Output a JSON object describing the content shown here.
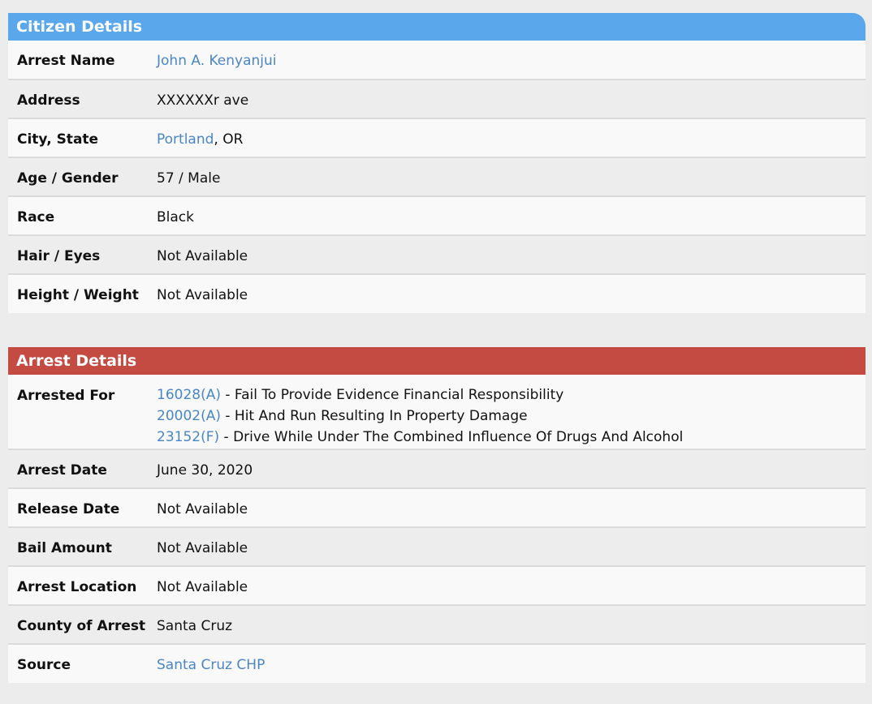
{
  "citizen": {
    "header": "Citizen Details",
    "header_color": "#5aa8eb",
    "rows": [
      {
        "label": "Arrest Name",
        "value": "John A. Kenyanjui"
      },
      {
        "label": "Address",
        "value": "XXXXXXr ave"
      },
      {
        "label": "City, State",
        "city": "Portland",
        "state": ", OR"
      },
      {
        "label": "Age / Gender",
        "value": "57 / Male"
      },
      {
        "label": "Race",
        "value": "Black"
      },
      {
        "label": "Hair / Eyes",
        "value": "Not Available"
      },
      {
        "label": "Height / Weight",
        "value": "Not Available"
      }
    ]
  },
  "arrest": {
    "header": "Arrest Details",
    "header_color": "#c44b42",
    "charges_label": "Arrested For",
    "charges": [
      {
        "code": "16028(A)",
        "description": " - Fail To Provide Evidence Financial Responsibility"
      },
      {
        "code": "20002(A)",
        "description": " - Hit And Run Resulting In Property Damage"
      },
      {
        "code": "23152(F)",
        "description": " - Drive While Under The Combined Influence Of Drugs And Alcohol"
      }
    ],
    "rows": [
      {
        "label": "Arrest Date",
        "value": "June 30, 2020"
      },
      {
        "label": "Release Date",
        "value": "Not Available"
      },
      {
        "label": "Bail Amount",
        "value": "Not Available"
      },
      {
        "label": "Arrest Location",
        "value": "Not Available"
      },
      {
        "label": "County of Arrest",
        "value": "Santa Cruz"
      },
      {
        "label": "Source",
        "value": "Santa Cruz CHP"
      }
    ]
  },
  "colors": {
    "link": "#4a86c5",
    "row_alt": "#ededed",
    "row_light": "#f9f9f9",
    "page_bg": "#ececec"
  }
}
